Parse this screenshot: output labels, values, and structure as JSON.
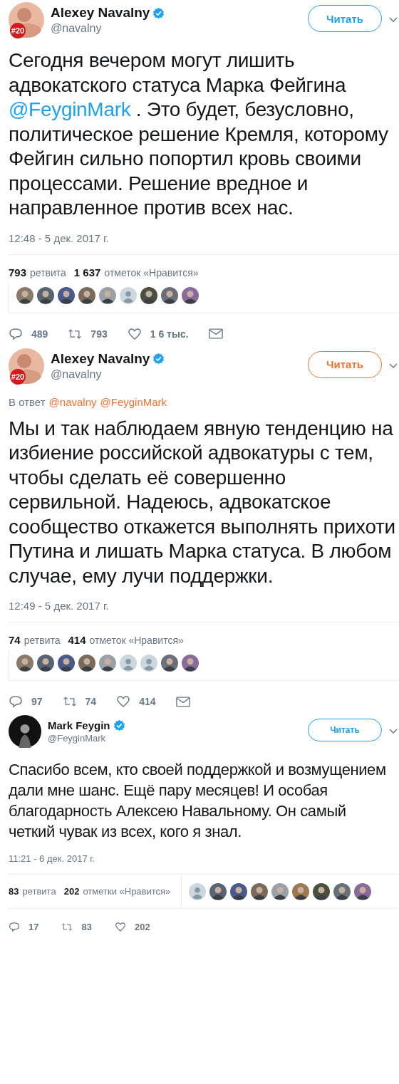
{
  "tweets": [
    {
      "kind": "large",
      "author": {
        "name": "Alexey Navalny",
        "handle": "@navalny",
        "verified": true,
        "avatar_badge": "#20"
      },
      "follow_button": {
        "label": "Читать",
        "hovered": false
      },
      "text": [
        {
          "kind": "text",
          "text": "Сегодня вечером могут лишить адвокатского статуса Марка Фейгина "
        },
        {
          "kind": "link",
          "text": "@FeyginMark"
        },
        {
          "kind": "text",
          "text": " . Это будет, безусловно, политическое решение Кремля, которому Фейгин сильно попортил кровь своими процессами. Решение вредное и направленное против всех нас."
        }
      ],
      "date": "12:48 - 5 дек. 2017 г.",
      "stats": {
        "retweets": "793",
        "retweets_label": "ретвита",
        "likes": "1 637",
        "likes_label": "отметок «Нравится»"
      },
      "likers": [
        {
          "kind": "photo"
        },
        {
          "kind": "photo"
        },
        {
          "kind": "photo"
        },
        {
          "kind": "photo"
        },
        {
          "kind": "photo"
        },
        {
          "kind": "default"
        },
        {
          "kind": "photo"
        },
        {
          "kind": "photo"
        },
        {
          "kind": "photo"
        }
      ],
      "actions": {
        "replies": "489",
        "retweets": "793",
        "likes": "1 6 тыс.",
        "dm": true
      }
    },
    {
      "kind": "large",
      "author": {
        "name": "Alexey Navalny",
        "handle": "@navalny",
        "verified": true,
        "avatar_badge": "#20"
      },
      "follow_button": {
        "label": "Читать",
        "hovered": true
      },
      "reply_to": [
        {
          "kind": "text",
          "text": "В ответ"
        },
        {
          "kind": "link",
          "text": "@navalny"
        },
        {
          "kind": "link",
          "text": "@FeyginMark"
        }
      ],
      "text": [
        {
          "kind": "text",
          "text": "Мы и так наблюдаем явную тенденцию на избиение российской адвокатуры с тем, чтобы сделать её совершенно сервильной. Надеюсь, адвокатское сообщество откажется выполнять прихоти Путина и лишать Марка статуса. В любом случае, ему лучи поддержки."
        }
      ],
      "date": "12:49 - 5 дек. 2017 г.",
      "stats": {
        "retweets": "74",
        "retweets_label": "ретвита",
        "likes": "414",
        "likes_label": "отметок «Нравится»"
      },
      "likers": [
        {
          "kind": "photo"
        },
        {
          "kind": "photo"
        },
        {
          "kind": "photo"
        },
        {
          "kind": "photo"
        },
        {
          "kind": "photo"
        },
        {
          "kind": "default"
        },
        {
          "kind": "default"
        },
        {
          "kind": "photo"
        },
        {
          "kind": "photo"
        }
      ],
      "actions": {
        "replies": "97",
        "retweets": "74",
        "likes": "414",
        "dm": true
      }
    },
    {
      "kind": "compact",
      "author": {
        "name": "Mark Feygin",
        "handle": "@FeyginMark",
        "verified": true
      },
      "follow_button": {
        "label": "Читать",
        "hovered": false
      },
      "text": [
        {
          "kind": "text",
          "text": "Спасибо всем, кто своей поддержкой и возмущением дали мне шанс. Ещё пару месяцев! И особая благодарность Алексею Навальному. Он самый четкий чувак из всех, кого я знал."
        }
      ],
      "date": "11:21 - 6 дек. 2017 г.",
      "stats": {
        "retweets": "83",
        "retweets_label": "ретвита",
        "likes": "202",
        "likes_label": "отметки «Нравится»"
      },
      "likers": [
        {
          "kind": "default"
        },
        {
          "kind": "photo"
        },
        {
          "kind": "photo"
        },
        {
          "kind": "photo"
        },
        {
          "kind": "photo"
        },
        {
          "kind": "photo"
        },
        {
          "kind": "photo"
        },
        {
          "kind": "photo"
        },
        {
          "kind": "photo"
        }
      ],
      "actions": {
        "replies": "17",
        "retweets": "83",
        "likes": "202"
      }
    }
  ]
}
